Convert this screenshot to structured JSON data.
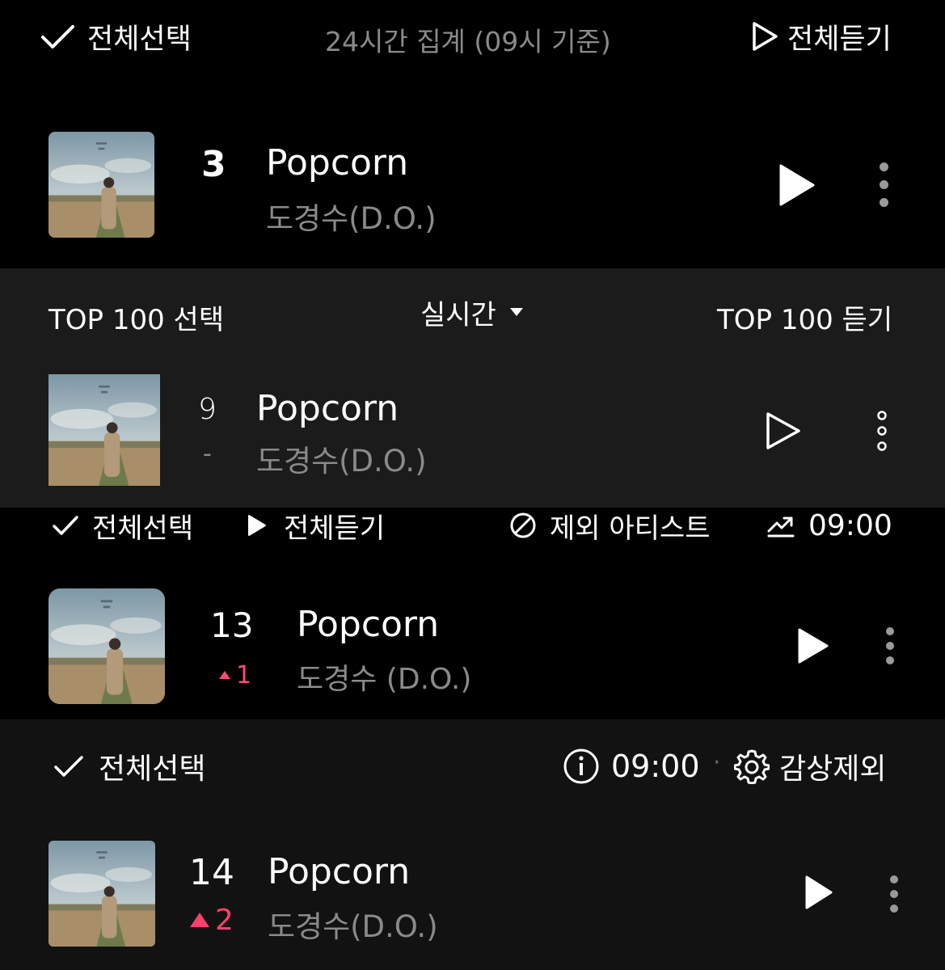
{
  "section1": {
    "select_all": "전체선택",
    "aggregation": "24시간 집계 (09시 기준)",
    "play_all": "전체듣기",
    "rank": "3",
    "title": "Popcorn",
    "artist": "도경수(D.O.)"
  },
  "section2": {
    "top100_select": "TOP 100 선택",
    "realtime": "실시간",
    "top100_play": "TOP 100 듣기",
    "rank": "9",
    "change": "-",
    "title": "Popcorn",
    "artist": "도경수(D.O.)"
  },
  "section3": {
    "select_all": "전체선택",
    "play_all": "전체듣기",
    "exclude_artist": "제외 아티스트",
    "time": "09:00",
    "rank": "13",
    "change": "1",
    "title": "Popcorn",
    "artist": "도경수 (D.O.)"
  },
  "section4": {
    "select_all": "전체선택",
    "time": "09:00",
    "separator": "·",
    "exclude_listen": "감상제외",
    "rank": "14",
    "change": "2",
    "title": "Popcorn",
    "artist": "도경수(D.O.)"
  },
  "colors": {
    "background": "#000000",
    "panel_dark": "#1b1b1b",
    "panel_mid": "#121212",
    "muted_text": "#8a8a8a",
    "rank_up": "#ff4a72"
  },
  "icons": [
    "check-icon",
    "play-outline-icon",
    "play-icon",
    "more-vertical-icon",
    "caret-down-icon",
    "block-icon",
    "trend-icon",
    "info-icon",
    "gear-icon",
    "triangle-up-icon"
  ]
}
